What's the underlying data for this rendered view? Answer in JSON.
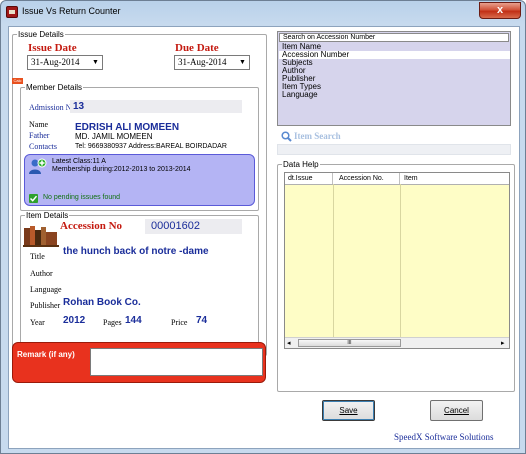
{
  "window": {
    "title": "Issue Vs Return Counter",
    "close_label": "x"
  },
  "issue_details": {
    "legend": "Issue Details",
    "issue_date_label": "Issue Date",
    "issue_date_value": "31-Aug-2014",
    "due_date_label": "Due Date",
    "due_date_value": "31-Aug-2014",
    "badge": "Calc"
  },
  "member_details": {
    "legend": "Member Details",
    "admission_label": "Admission No.",
    "admission_value": "13",
    "name_label": "Name",
    "name_value": "EDRISH ALI MOMEEN",
    "father_label": "Father",
    "father_value": "MD. JAMIL MOMEEN",
    "contacts_label": "Contacts",
    "contacts_value": "Tel: 9669380937 Address:BAREAL BOIRDADAR",
    "latest_class": "Latest Class:11 A",
    "membership": "Membership during:2012-2013 to 2013-2014",
    "pending_status": "No pending issues found"
  },
  "item_details": {
    "legend": "Item Details",
    "accession_label": "Accession No",
    "accession_value": "00001602",
    "title_label": "Title",
    "title_value": "the hunch back of notre -dame",
    "author_label": "Author",
    "author_value": "",
    "language_label": "Language",
    "language_value": "",
    "publisher_label": "Publisher",
    "publisher_value": "Rohan Book Co.",
    "year_label": "Year",
    "year_value": "2012",
    "pages_label": "Pages",
    "pages_value": "144",
    "price_label": "Price",
    "price_value": "74"
  },
  "remark": {
    "label": "Remark (if any)",
    "value": ""
  },
  "search": {
    "header": "Search on Accession Number",
    "options": [
      "Item Name",
      "Accession Number",
      "Subjects",
      "Author",
      "Publisher",
      "Item Types",
      "Language"
    ],
    "selected_index": 1,
    "item_search_placeholder": "Item Search"
  },
  "data_help": {
    "legend": "Data Help",
    "columns": [
      "dt.Issue",
      "Accession No.",
      "Item"
    ],
    "scroll_thumb": "III"
  },
  "buttons": {
    "save": "Save",
    "cancel": "Cancel"
  },
  "footer": {
    "credit": "SpeedX Software Solutions"
  },
  "colors": {
    "title_bar": "#c7daee",
    "accent_red": "#c41a10",
    "label_blue": "#1a2d9a",
    "remark_red": "#e8321e",
    "membership_box": "#b4b4f4",
    "grid_yellow": "#fefdc6",
    "list_lavender": "#d6d4ec"
  }
}
